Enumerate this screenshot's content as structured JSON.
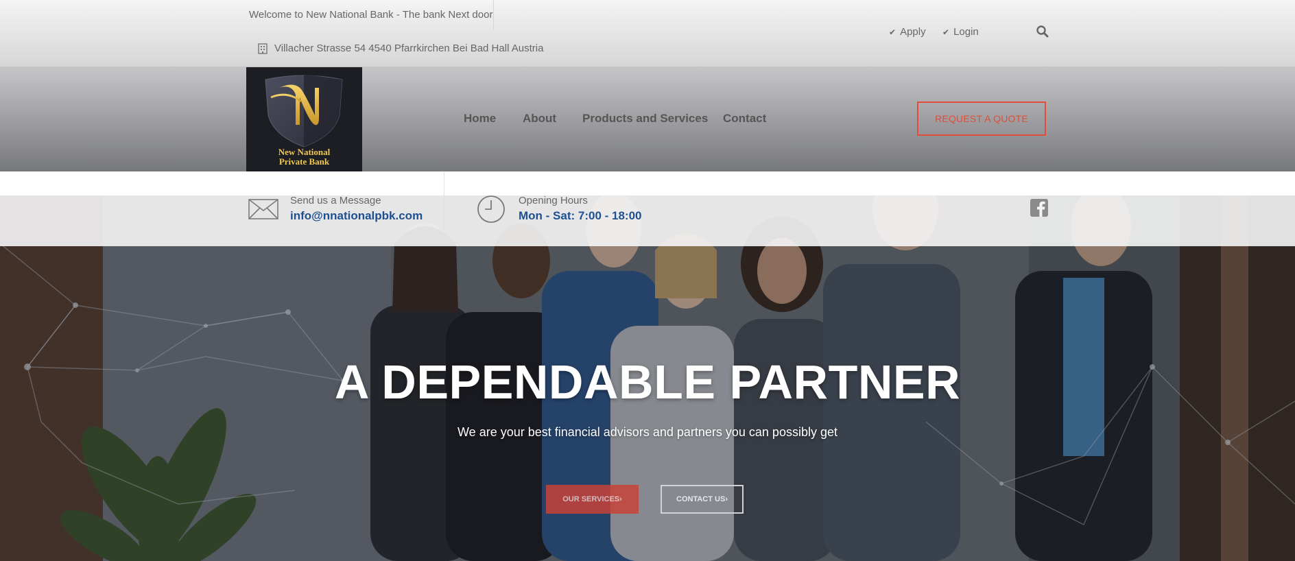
{
  "topbar": {
    "welcome": "Welcome to New National Bank - The bank Next door",
    "address": "Villacher Strasse 54 4540 Pfarrkirchen Bei Bad Hall Austria",
    "links": [
      {
        "label": "Apply",
        "icon": "check-icon"
      },
      {
        "label": "Login",
        "icon": "check-icon"
      }
    ],
    "search_icon": "search-icon"
  },
  "logo": {
    "line1": "New National",
    "line2": "Private Bank",
    "letter": "N"
  },
  "nav": {
    "items": [
      {
        "label": "Home"
      },
      {
        "label": "About"
      },
      {
        "label": "Products and Services",
        "has_dropdown": true
      },
      {
        "label": "Contact"
      }
    ]
  },
  "header": {
    "quote_button": "REQUEST A QUOTE"
  },
  "info": {
    "message_label": "Send us a Message",
    "message_value": "info@nnationalpbk.com",
    "hours_label": "Opening Hours",
    "hours_value": "Mon - Sat: 7:00 - 18:00",
    "social_icon": "facebook-icon"
  },
  "hero": {
    "title": "A DEPENDABLE PARTNER",
    "subtitle": "We are your best financial advisors and partners you can possibly get",
    "services_button": "OUR SERVICES",
    "contact_button": "CONTACT US"
  },
  "colors": {
    "accent": "#e04d3a",
    "link_blue": "#1e4f8e",
    "logo_gold": "#f2c94c"
  }
}
